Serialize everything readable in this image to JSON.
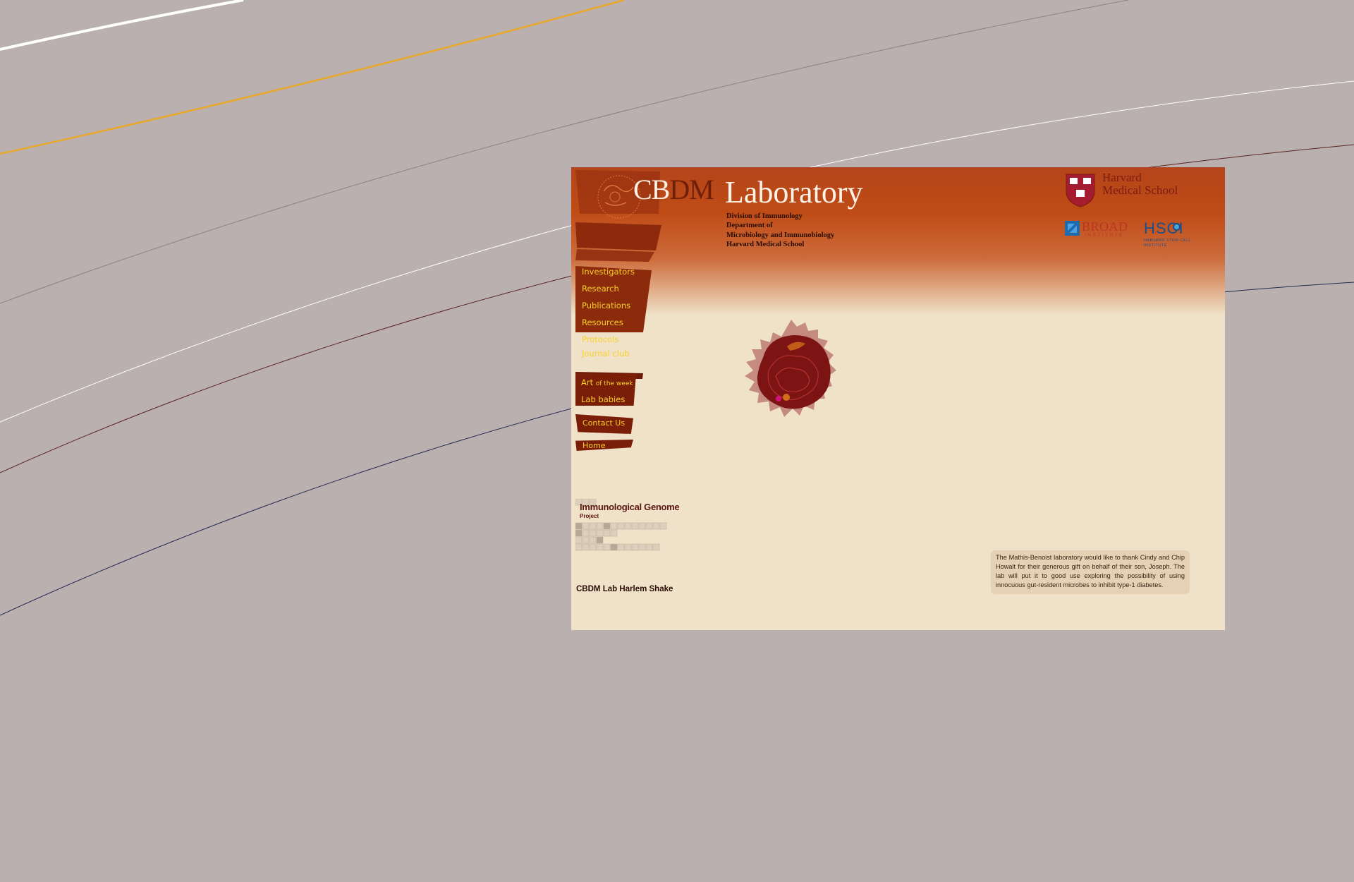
{
  "header": {
    "logo_cb": "CB",
    "logo_dm": "DM",
    "title": "Laboratory",
    "affiliation": [
      "Division of Immunology",
      "Department of",
      "Microbiology and Immunobiology",
      "Harvard Medical School"
    ]
  },
  "partners": {
    "hms_line1": "Harvard",
    "hms_line2": "Medical School",
    "broad_name": "BROAD",
    "broad_sub": "INSTITUTE",
    "hsci_name": "HSCI",
    "hsci_sub": "HARVARD STEM CELL INSTITUTE"
  },
  "nav": {
    "primary": [
      "Investigators",
      "Research",
      "Publications",
      "Resources",
      "Protocols",
      "Journal club"
    ],
    "art_main": "Art",
    "art_small": "of the week",
    "lab_babies": "Lab babies",
    "contact": "Contact Us",
    "home": "Home"
  },
  "igp": {
    "title": "Immunological Genome",
    "subtitle": "Project"
  },
  "harlem_shake": "CBDM Lab Harlem Shake",
  "announcement": "The Mathis-Benoist laboratory would like to thank Cindy and Chip Howalt for their generous gift on behalf of their son, Joseph. The lab will put it to good use exploring the possibility of using innocuous gut-resident microbes to inhibit type-1 diabetes.",
  "colors": {
    "desktop_bg": "#bab0b0",
    "page_bg": "#f0e2c8",
    "header_orange": "#bf4b16",
    "nav_dark": "#7a1e08",
    "nav_text": "#f6d228"
  },
  "icons": [
    "cbdm-emblem-icon",
    "harvard-shield-icon",
    "broad-logo-icon",
    "hsci-logo-icon",
    "cell-illustration-icon"
  ]
}
